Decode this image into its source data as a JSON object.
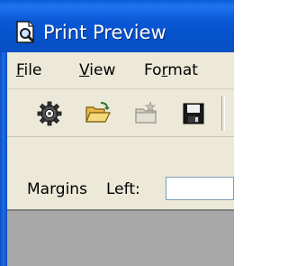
{
  "window": {
    "title": "Print Preview",
    "icon": "print-preview-document-icon"
  },
  "menu": {
    "items": [
      {
        "label": "File",
        "mnemonic": "F",
        "rest": "ile"
      },
      {
        "label": "View",
        "mnemonic": "V",
        "rest": "iew"
      },
      {
        "label": "Format",
        "mnemonic_prefix": "Fo",
        "mnemonic": "r",
        "rest": "mat"
      }
    ]
  },
  "toolbar": {
    "buttons": [
      {
        "name": "page-setup-icon",
        "enabled": true
      },
      {
        "name": "open-folder-icon",
        "enabled": true
      },
      {
        "name": "new-folder-icon",
        "enabled": false
      },
      {
        "name": "save-icon",
        "enabled": true
      }
    ]
  },
  "margins": {
    "label": "Margins",
    "left_label": "Left:",
    "left_value": ""
  },
  "colors": {
    "titlebar": "#0a58d6",
    "chrome": "#ece9d8",
    "preview_background": "#a8a8a8"
  }
}
